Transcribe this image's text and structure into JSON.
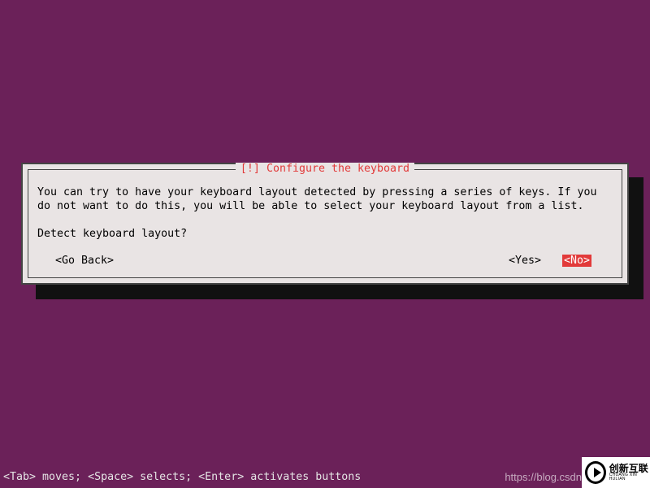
{
  "title": "[!] Configure the keyboard",
  "description": "You can try to have your keyboard layout detected by pressing a series of keys. If you do not want to do this, you will be able to select your keyboard layout from a list.",
  "prompt": "Detect keyboard layout?",
  "buttons": {
    "go_back": "<Go Back>",
    "yes": "<Yes>",
    "no": "<No>"
  },
  "help_bar": "<Tab> moves; <Space> selects; <Enter> activates buttons",
  "url_text": "https://blog.csdn",
  "watermark": {
    "cn": "创新互联",
    "en": "CHUANG XIN HULIAN"
  }
}
